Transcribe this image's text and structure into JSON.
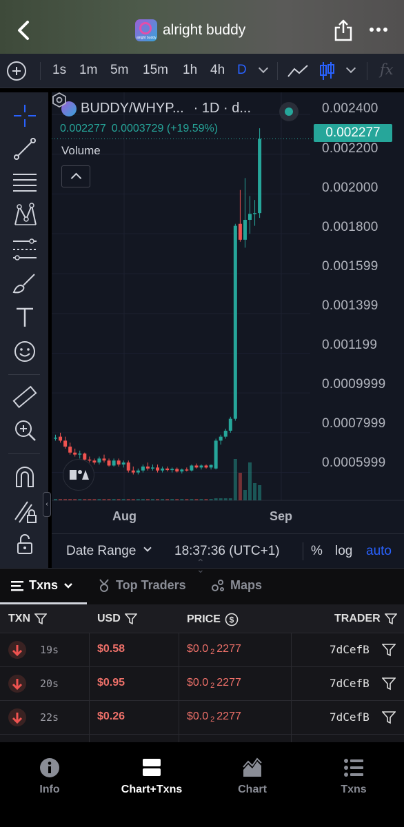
{
  "header": {
    "title": "alright buddy",
    "logo_text": "alright buddy",
    "back_icon": "chevron-left-icon",
    "share_icon": "share-icon",
    "more_icon": "more-horizontal-icon"
  },
  "toolbar": {
    "timeframes": [
      "1s",
      "1m",
      "5m",
      "15m",
      "1h",
      "4h",
      "D"
    ],
    "active_timeframe": "D",
    "fx_label": "fx"
  },
  "chart": {
    "symbol": "BUDDY/WHYP...",
    "interval": "· 1D · d...",
    "ohlc_last": "0.002277",
    "ohlc_change": "0.0003729 (+19.59%)",
    "volume_label": "Volume",
    "current_price": "0.002277",
    "price_axis": [
      "0.002400",
      "0.002200",
      "0.002000",
      "0.001800",
      "0.001599",
      "0.001399",
      "0.001199",
      "0.0009999",
      "0.0007999",
      "0.0005999"
    ],
    "time_axis": [
      "Aug",
      "Sep"
    ],
    "accent_up": "#26a69a",
    "accent_down": "#ef5350"
  },
  "chart_data": {
    "type": "candlestick",
    "symbol": "BUDDY/WHYP...",
    "interval": "1D",
    "ylim": [
      0.00046,
      0.00249
    ],
    "yticks": [
      0.0024,
      0.0022,
      0.002,
      0.0018,
      0.001599,
      0.001399,
      0.001199,
      0.0009999,
      0.0007999,
      0.0005999
    ],
    "x_labels": [
      "Aug",
      "Sep"
    ],
    "last_price": 0.002277,
    "change": 0.0003729,
    "change_percent": 19.59,
    "candles": [
      {
        "o": 0.00077,
        "h": 0.00079,
        "l": 0.00076,
        "c": 0.000775
      },
      {
        "o": 0.00078,
        "h": 0.0008,
        "l": 0.00075,
        "c": 0.00076
      },
      {
        "o": 0.00076,
        "h": 0.00078,
        "l": 0.00072,
        "c": 0.00073
      },
      {
        "o": 0.00073,
        "h": 0.00075,
        "l": 0.00069,
        "c": 0.0007
      },
      {
        "o": 0.0007,
        "h": 0.00072,
        "l": 0.00068,
        "c": 0.00069
      },
      {
        "o": 0.00069,
        "h": 0.00071,
        "l": 0.00067,
        "c": 0.000695
      },
      {
        "o": 0.000695,
        "h": 0.0007,
        "l": 0.00066,
        "c": 0.000665
      },
      {
        "o": 0.000665,
        "h": 0.00068,
        "l": 0.00065,
        "c": 0.00066
      },
      {
        "o": 0.00066,
        "h": 0.00067,
        "l": 0.00064,
        "c": 0.00065
      },
      {
        "o": 0.00065,
        "h": 0.00068,
        "l": 0.00064,
        "c": 0.00067
      },
      {
        "o": 0.00067,
        "h": 0.00069,
        "l": 0.00065,
        "c": 0.00066
      },
      {
        "o": 0.00066,
        "h": 0.00067,
        "l": 0.00063,
        "c": 0.000635
      },
      {
        "o": 0.000635,
        "h": 0.00067,
        "l": 0.00063,
        "c": 0.00066
      },
      {
        "o": 0.00066,
        "h": 0.00067,
        "l": 0.00063,
        "c": 0.00064
      },
      {
        "o": 0.00064,
        "h": 0.00066,
        "l": 0.000625,
        "c": 0.00065
      },
      {
        "o": 0.00065,
        "h": 0.00066,
        "l": 0.0006,
        "c": 0.00061
      },
      {
        "o": 0.00061,
        "h": 0.00063,
        "l": 0.00059,
        "c": 0.0006
      },
      {
        "o": 0.0006,
        "h": 0.00062,
        "l": 0.00059,
        "c": 0.00061
      },
      {
        "o": 0.00061,
        "h": 0.00064,
        "l": 0.0006,
        "c": 0.00063
      },
      {
        "o": 0.00063,
        "h": 0.00065,
        "l": 0.00061,
        "c": 0.00062
      },
      {
        "o": 0.00062,
        "h": 0.00064,
        "l": 0.00061,
        "c": 0.000625
      },
      {
        "o": 0.000625,
        "h": 0.00064,
        "l": 0.0006,
        "c": 0.00061
      },
      {
        "o": 0.00061,
        "h": 0.00063,
        "l": 0.0006,
        "c": 0.00062
      },
      {
        "o": 0.00062,
        "h": 0.00063,
        "l": 0.000605,
        "c": 0.000612
      },
      {
        "o": 0.000612,
        "h": 0.000625,
        "l": 0.0006,
        "c": 0.000618
      },
      {
        "o": 0.000618,
        "h": 0.000625,
        "l": 0.0006,
        "c": 0.000605
      },
      {
        "o": 0.000605,
        "h": 0.00062,
        "l": 0.000595,
        "c": 0.000615
      },
      {
        "o": 0.000615,
        "h": 0.000625,
        "l": 0.000605,
        "c": 0.00061
      },
      {
        "o": 0.00061,
        "h": 0.00064,
        "l": 0.000605,
        "c": 0.000635
      },
      {
        "o": 0.000635,
        "h": 0.000645,
        "l": 0.00062,
        "c": 0.000625
      },
      {
        "o": 0.000625,
        "h": 0.00064,
        "l": 0.000615,
        "c": 0.000635
      },
      {
        "o": 0.000635,
        "h": 0.00064,
        "l": 0.00062,
        "c": 0.000625
      },
      {
        "o": 0.000625,
        "h": 0.00064,
        "l": 0.000615,
        "c": 0.000638
      },
      {
        "o": 0.00062,
        "h": 0.00077,
        "l": 0.000615,
        "c": 0.00076
      },
      {
        "o": 0.00076,
        "h": 0.00079,
        "l": 0.00074,
        "c": 0.00078
      },
      {
        "o": 0.00078,
        "h": 0.00082,
        "l": 0.00077,
        "c": 0.00081
      },
      {
        "o": 0.00081,
        "h": 0.00088,
        "l": 0.0008,
        "c": 0.00087
      },
      {
        "o": 0.00087,
        "h": 0.00185,
        "l": 0.00086,
        "c": 0.00184
      },
      {
        "o": 0.00185,
        "h": 0.00202,
        "l": 0.00176,
        "c": 0.00177
      },
      {
        "o": 0.00177,
        "h": 0.00208,
        "l": 0.00173,
        "c": 0.00187
      },
      {
        "o": 0.00187,
        "h": 0.00199,
        "l": 0.0018,
        "c": 0.0019
      },
      {
        "o": 0.0019,
        "h": 0.00197,
        "l": 0.00184,
        "c": 0.001904
      },
      {
        "o": 0.001904,
        "h": 0.00233,
        "l": 0.00188,
        "c": 0.002277
      }
    ]
  },
  "chart_footer": {
    "date_range": "Date Range",
    "clock": "18:37:36 (UTC+1)",
    "percent": "%",
    "log": "log",
    "auto": "auto"
  },
  "tabs": [
    {
      "label": "Txns",
      "icon": "list-icon",
      "active": true
    },
    {
      "label": "Top Traders",
      "icon": "medal-icon",
      "active": false
    },
    {
      "label": "Maps",
      "icon": "bubbles-icon",
      "active": false
    }
  ],
  "table": {
    "headers": {
      "txn": "TXN",
      "usd": "USD",
      "price": "PRICE",
      "trader": "TRADER"
    },
    "rows": [
      {
        "type": "sell",
        "age": "19s",
        "usd": "$0.58",
        "price_prefix": "$0.0",
        "price_zeros": "2",
        "price_digits": "2277",
        "trader": "7dCefB"
      },
      {
        "type": "sell",
        "age": "20s",
        "usd": "$0.95",
        "price_prefix": "$0.0",
        "price_zeros": "2",
        "price_digits": "2277",
        "trader": "7dCefB"
      },
      {
        "type": "sell",
        "age": "22s",
        "usd": "$0.26",
        "price_prefix": "$0.0",
        "price_zeros": "2",
        "price_digits": "2277",
        "trader": "7dCefB"
      }
    ]
  },
  "bottom_nav": [
    {
      "label": "Info",
      "icon": "info-icon",
      "active": false
    },
    {
      "label": "Chart+Txns",
      "icon": "split-layout-icon",
      "active": true
    },
    {
      "label": "Chart",
      "icon": "area-chart-icon",
      "active": false
    },
    {
      "label": "Txns",
      "icon": "list-icon",
      "active": false
    }
  ]
}
